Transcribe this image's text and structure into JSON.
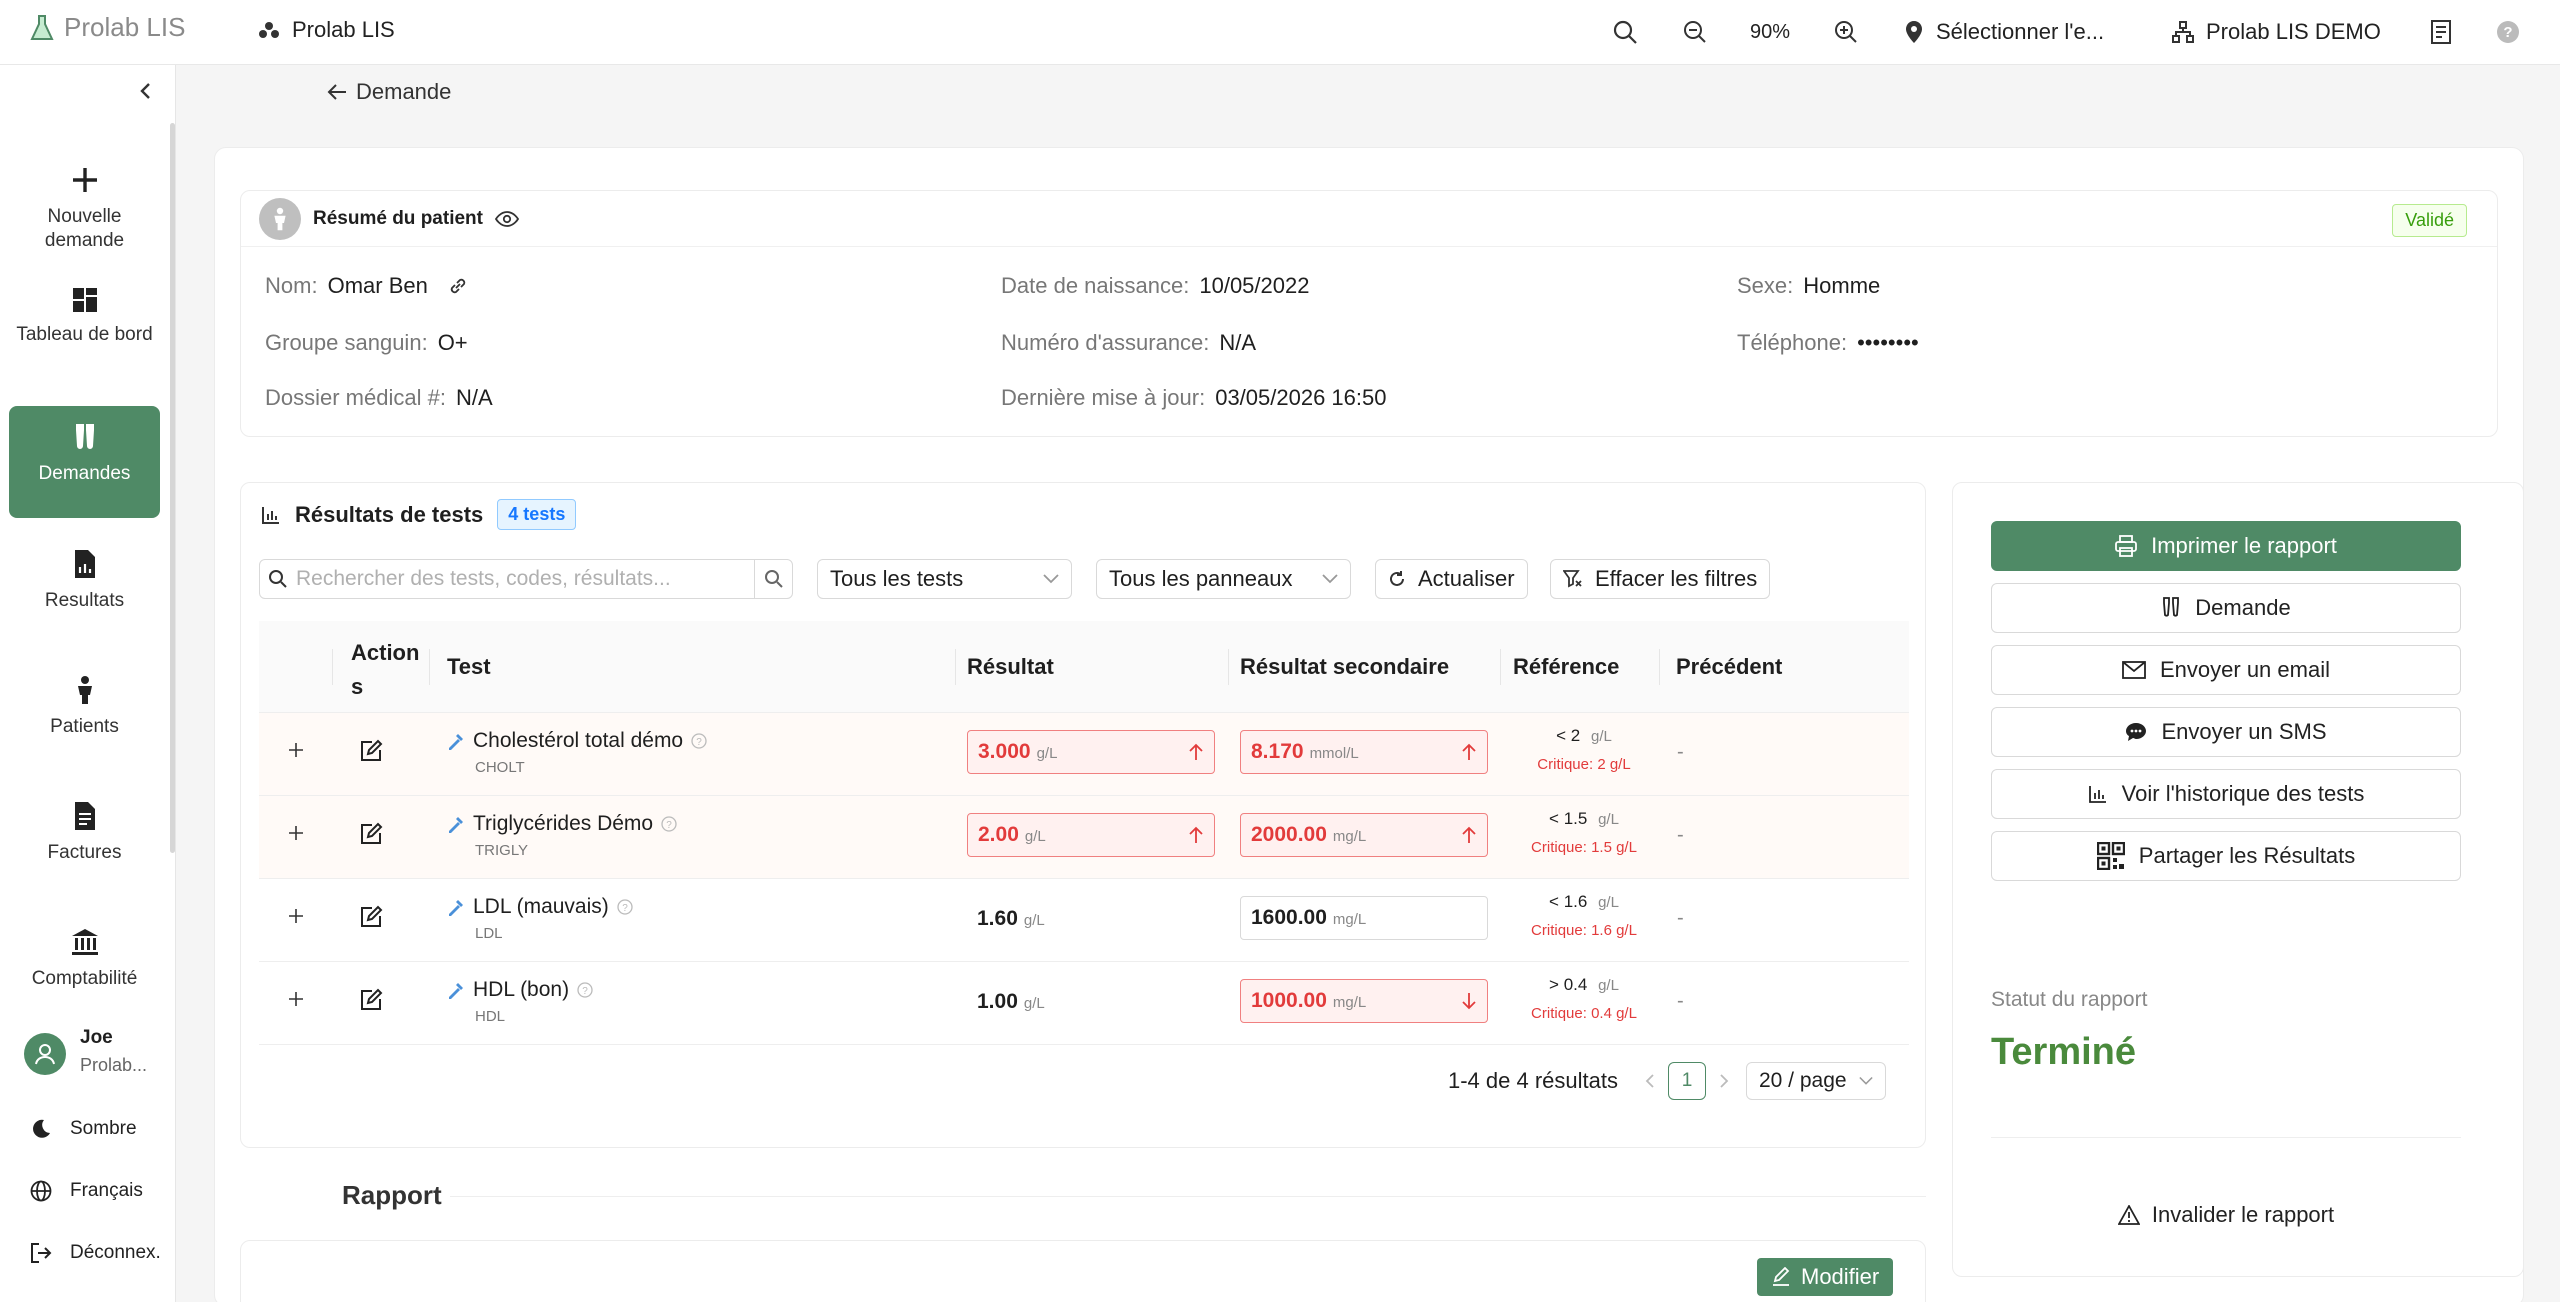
{
  "app": {
    "brand": "Prolab LIS",
    "crumb": "Prolab LIS"
  },
  "topbar": {
    "zoom": "90%",
    "location": "Sélectionner l'e...",
    "org": "Prolab LIS DEMO"
  },
  "sidebar": {
    "items": [
      {
        "label": "Nouvelle demande",
        "icon": "plus-icon"
      },
      {
        "label": "Tableau de bord",
        "icon": "dashboard-icon"
      },
      {
        "label": "Demandes",
        "icon": "test-tubes-icon"
      },
      {
        "label": "Resultats",
        "icon": "report-icon"
      },
      {
        "label": "Patients",
        "icon": "person-icon"
      },
      {
        "label": "Factures",
        "icon": "invoice-icon"
      },
      {
        "label": "Comptabilité",
        "icon": "bank-icon"
      }
    ],
    "user": {
      "name": "Joe",
      "org": "Prolab..."
    },
    "theme": "Sombre",
    "language": "Français",
    "logout": "Déconnex."
  },
  "back_label": "Demande",
  "patient": {
    "title": "Résumé du patient",
    "status": "Validé",
    "nom_label": "Nom",
    "nom": "Omar Ben",
    "dob_label": "Date de naissance",
    "dob": "10/05/2022",
    "sexe_label": "Sexe",
    "sexe": "Homme",
    "groupe_label": "Groupe sanguin",
    "groupe": "O+",
    "assurance_label": "Numéro d'assurance",
    "assurance": "N/A",
    "tel_label": "Téléphone",
    "tel": "••••••••",
    "dossier_label": "Dossier médical #",
    "dossier": "N/A",
    "maj_label": "Dernière mise à jour",
    "maj": "03/05/2026 16:50"
  },
  "results": {
    "title": "Résultats de tests",
    "count": "4 tests",
    "search_placeholder": "Rechercher des tests, codes, résultats...",
    "filter_tests": "Tous les tests",
    "filter_panels": "Tous les panneaux",
    "refresh": "Actualiser",
    "clear": "Effacer les filtres",
    "columns": {
      "actions": "Action s",
      "test": "Test",
      "result": "Résultat",
      "secondary": "Résultat secondaire",
      "reference": "Référence",
      "previous": "Précédent"
    },
    "rows": [
      {
        "name": "Cholestérol total démo",
        "code": "CHOLT",
        "result": "3.000",
        "unit": "g/L",
        "sec": "8.170",
        "sec_unit": "mmol/L",
        "ref": "< 2",
        "ref_unit": "g/L",
        "crit": "Critique: 2 g/L",
        "prev": "-"
      },
      {
        "name": "Triglycérides Démo",
        "code": "TRIGLY",
        "result": "2.00",
        "unit": "g/L",
        "sec": "2000.00",
        "sec_unit": "mg/L",
        "ref": "< 1.5",
        "ref_unit": "g/L",
        "crit": "Critique: 1.5 g/L",
        "prev": "-"
      },
      {
        "name": "LDL (mauvais)",
        "code": "LDL",
        "result": "1.60",
        "unit": "g/L",
        "sec": "1600.00",
        "sec_unit": "mg/L",
        "ref": "< 1.6",
        "ref_unit": "g/L",
        "crit": "Critique: 1.6 g/L",
        "prev": "-"
      },
      {
        "name": "HDL (bon)",
        "code": "HDL",
        "result": "1.00",
        "unit": "g/L",
        "sec": "1000.00",
        "sec_unit": "mg/L",
        "ref": "> 0.4",
        "ref_unit": "g/L",
        "crit": "Critique: 0.4 g/L",
        "prev": "-"
      }
    ],
    "pager": {
      "summary": "1-4 de 4 résultats",
      "page": "1",
      "size": "20 / page"
    }
  },
  "rapport": {
    "title": "Rapport",
    "edit": "Modifier"
  },
  "actions": {
    "print": "Imprimer le rapport",
    "demande": "Demande",
    "email": "Envoyer un email",
    "sms": "Envoyer un SMS",
    "history": "Voir l'historique des tests",
    "share": "Partager les Résultats",
    "status_label": "Statut du rapport",
    "status_value": "Terminé",
    "invalidate": "Invalider le rapport"
  },
  "colors": {
    "accent": "#4f8a66",
    "danger": "#e23b3b",
    "done": "#4a8a3c"
  }
}
